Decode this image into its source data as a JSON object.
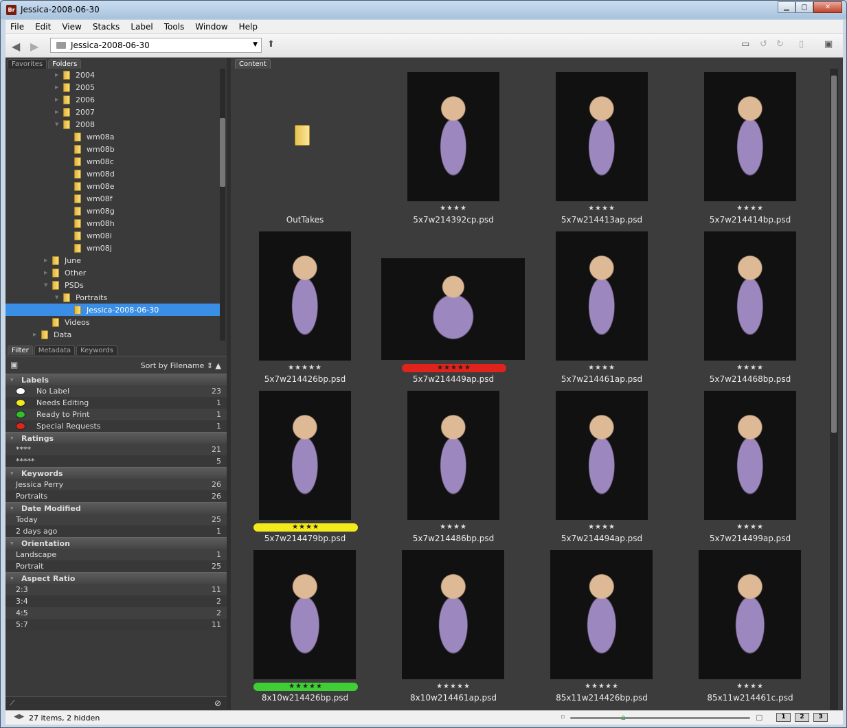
{
  "window": {
    "app_badge": "Br",
    "title": "Jessica-2008-06-30"
  },
  "menu": [
    "File",
    "Edit",
    "View",
    "Stacks",
    "Label",
    "Tools",
    "Window",
    "Help"
  ],
  "toolbar": {
    "path": "Jessica-2008-06-30"
  },
  "left_tabs": [
    "Favorites",
    "Folders"
  ],
  "folders": [
    {
      "label": "2004",
      "indent": 1,
      "expand": "▶"
    },
    {
      "label": "2005",
      "indent": 1,
      "expand": "▶"
    },
    {
      "label": "2006",
      "indent": 1,
      "expand": "▶"
    },
    {
      "label": "2007",
      "indent": 1,
      "expand": "▶"
    },
    {
      "label": "2008",
      "indent": 1,
      "expand": "▼"
    },
    {
      "label": "wm08a",
      "indent": 2,
      "expand": ""
    },
    {
      "label": "wm08b",
      "indent": 2,
      "expand": ""
    },
    {
      "label": "wm08c",
      "indent": 2,
      "expand": ""
    },
    {
      "label": "wm08d",
      "indent": 2,
      "expand": ""
    },
    {
      "label": "wm08e",
      "indent": 2,
      "expand": ""
    },
    {
      "label": "wm08f",
      "indent": 2,
      "expand": ""
    },
    {
      "label": "wm08g",
      "indent": 2,
      "expand": ""
    },
    {
      "label": "wm08h",
      "indent": 2,
      "expand": ""
    },
    {
      "label": "wm08i",
      "indent": 2,
      "expand": ""
    },
    {
      "label": "wm08j",
      "indent": 2,
      "expand": ""
    },
    {
      "label": "June",
      "indent": 0,
      "expand": "▶"
    },
    {
      "label": "Other",
      "indent": 0,
      "expand": "▶"
    },
    {
      "label": "PSDs",
      "indent": 0,
      "expand": "▼"
    },
    {
      "label": "Portraits",
      "indent": 1,
      "expand": "▼"
    },
    {
      "label": "Jessica-2008-06-30",
      "indent": 2,
      "expand": "",
      "selected": true
    },
    {
      "label": "Videos",
      "indent": 0,
      "expand": ""
    },
    {
      "label": "Data",
      "indent": -1,
      "expand": "▶"
    }
  ],
  "filter_tabs": [
    "Filter",
    "Metadata",
    "Keywords"
  ],
  "sort_label": "Sort by Filename",
  "filters": [
    {
      "category": "Labels",
      "rows": [
        {
          "label": "No Label",
          "count": "23",
          "dot": "#ffffff"
        },
        {
          "label": "Needs Editing",
          "count": "1",
          "dot": "#f3ea1c"
        },
        {
          "label": "Ready to Print",
          "count": "1",
          "dot": "#31c028"
        },
        {
          "label": "Special Requests",
          "count": "1",
          "dot": "#e0241c"
        }
      ]
    },
    {
      "category": "Ratings",
      "rows": [
        {
          "label": "****",
          "count": "21"
        },
        {
          "label": "*****",
          "count": "5"
        }
      ]
    },
    {
      "category": "Keywords",
      "rows": [
        {
          "label": "Jessica Perry",
          "count": "26"
        },
        {
          "label": "Portraits",
          "count": "26"
        }
      ]
    },
    {
      "category": "Date Modified",
      "rows": [
        {
          "label": "Today",
          "count": "25"
        },
        {
          "label": "2 days ago",
          "count": "1"
        }
      ]
    },
    {
      "category": "Orientation",
      "rows": [
        {
          "label": "Landscape",
          "count": "1"
        },
        {
          "label": "Portrait",
          "count": "25"
        }
      ]
    },
    {
      "category": "Aspect Ratio",
      "rows": [
        {
          "label": "2:3",
          "count": "11"
        },
        {
          "label": "3:4",
          "count": "2"
        },
        {
          "label": "4:5",
          "count": "2"
        },
        {
          "label": "5:7",
          "count": "11"
        }
      ]
    }
  ],
  "content_tab": "Content",
  "items": [
    {
      "name": "OutTakes",
      "type": "folder",
      "stars": "",
      "label_color": ""
    },
    {
      "name": "5x7w214392cp.psd",
      "stars": "★★★★",
      "label_color": ""
    },
    {
      "name": "5x7w214413ap.psd",
      "stars": "★★★★",
      "label_color": ""
    },
    {
      "name": "5x7w214414bp.psd",
      "stars": "★★★★",
      "label_color": ""
    },
    {
      "name": "5x7w214426bp.psd",
      "stars": "★★★★★",
      "label_color": ""
    },
    {
      "name": "5x7w214449ap.psd",
      "stars": "★★★★★",
      "label_color": "#e0241c",
      "landscape": true
    },
    {
      "name": "5x7w214461ap.psd",
      "stars": "★★★★",
      "label_color": ""
    },
    {
      "name": "5x7w214468bp.psd",
      "stars": "★★★★",
      "label_color": ""
    },
    {
      "name": "5x7w214479bp.psd",
      "stars": "★★★★",
      "label_color": "#f3ea1c"
    },
    {
      "name": "5x7w214486bp.psd",
      "stars": "★★★★",
      "label_color": ""
    },
    {
      "name": "5x7w214494ap.psd",
      "stars": "★★★★",
      "label_color": ""
    },
    {
      "name": "5x7w214499ap.psd",
      "stars": "★★★★",
      "label_color": ""
    },
    {
      "name": "8x10w214426bp.psd",
      "stars": "★★★★★",
      "label_color": "#3fce35"
    },
    {
      "name": "8x10w214461ap.psd",
      "stars": "★★★★★",
      "label_color": ""
    },
    {
      "name": "85x11w214426bp.psd",
      "stars": "★★★★★",
      "label_color": ""
    },
    {
      "name": "85x11w214461c.psd",
      "stars": "★★★★",
      "label_color": ""
    }
  ],
  "status": {
    "text": "27 items, 2 hidden",
    "views": [
      "1",
      "2",
      "3"
    ]
  },
  "icons": [
    "back-icon",
    "forward-icon",
    "folder-icon",
    "dropdown-icon",
    "up-folder-icon",
    "new-folder-icon",
    "rotate-left-icon",
    "rotate-right-icon",
    "trash-icon",
    "compact-mode-icon",
    "sort-order-icon",
    "filter-icon",
    "clear-filter-icon",
    "zoom-out-icon",
    "zoom-in-icon"
  ]
}
